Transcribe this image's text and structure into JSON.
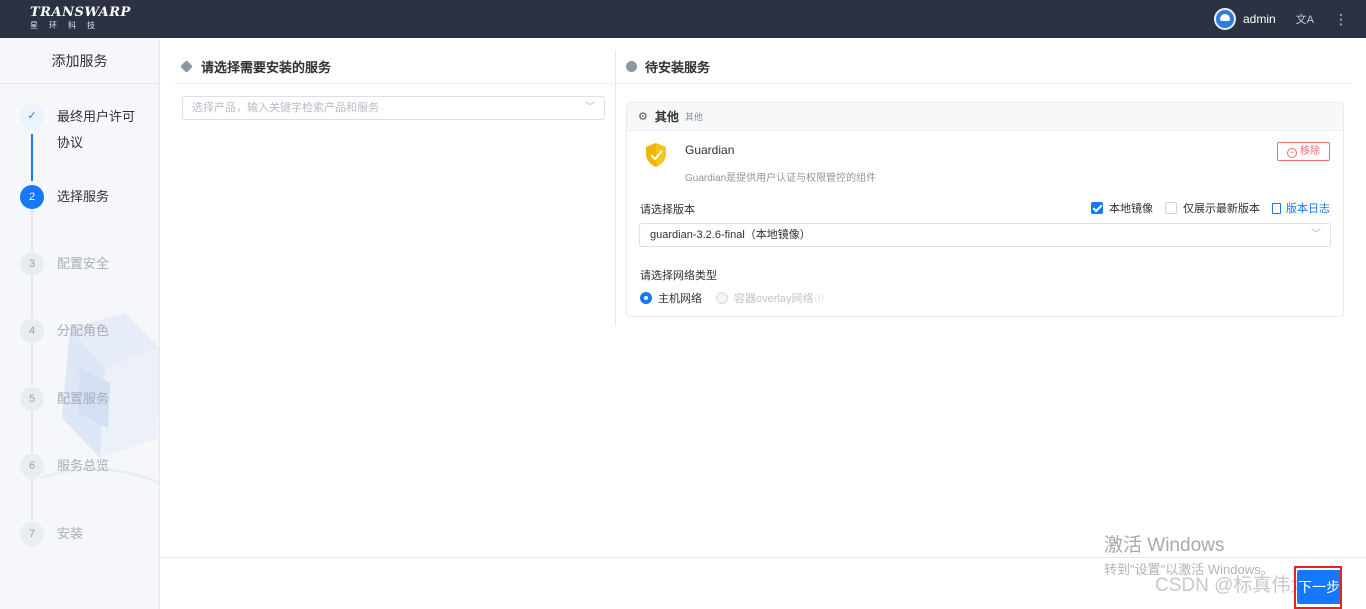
{
  "header": {
    "brand": "TRANSWARP",
    "brand_sub": "星环科技",
    "user": "admin",
    "lang_icon": "translate-icon",
    "more_icon": "more-icon"
  },
  "sidebar": {
    "title": "添加服务",
    "steps": [
      {
        "num": "✓",
        "label": "最终用户许可协议",
        "state": "done"
      },
      {
        "num": "2",
        "label": "选择服务",
        "state": "active"
      },
      {
        "num": "3",
        "label": "配置安全",
        "state": "todo"
      },
      {
        "num": "4",
        "label": "分配角色",
        "state": "todo"
      },
      {
        "num": "5",
        "label": "配置服务",
        "state": "todo"
      },
      {
        "num": "6",
        "label": "服务总览",
        "state": "todo"
      },
      {
        "num": "7",
        "label": "安装",
        "state": "todo"
      }
    ]
  },
  "left_panel": {
    "title": "请选择需要安装的服务",
    "search_placeholder": "选择产品，输入关键字检索产品和服务"
  },
  "right_panel": {
    "title": "待安装服务",
    "group": {
      "name": "其他",
      "tag": "其他"
    },
    "service": {
      "name": "Guardian",
      "description": "Guardian是提供用户认证与权限管控的组件",
      "remove_label": "移除",
      "version_label": "请选择版本",
      "opt_local_image": "本地镜像",
      "opt_local_image_checked": true,
      "opt_latest_only": "仅展示最新版本",
      "opt_latest_only_checked": false,
      "version_log": "版本日志",
      "version_value": "guardian-3.2.6-final（本地镜像）",
      "network_label": "请选择网络类型",
      "network_host": "主机网络",
      "network_overlay": "容器overlay网络",
      "network_selected": "host"
    }
  },
  "footer": {
    "watermark_title": "激活 Windows",
    "watermark_sub": "转到\"设置\"以激活 Windows。",
    "csdn_text": "CSDN @标真伟大",
    "next_label": "下一步"
  },
  "colors": {
    "topbar": "#2b3241",
    "primary": "#1677ff",
    "danger": "#f56c6c",
    "highlight_box": "#e82323"
  }
}
